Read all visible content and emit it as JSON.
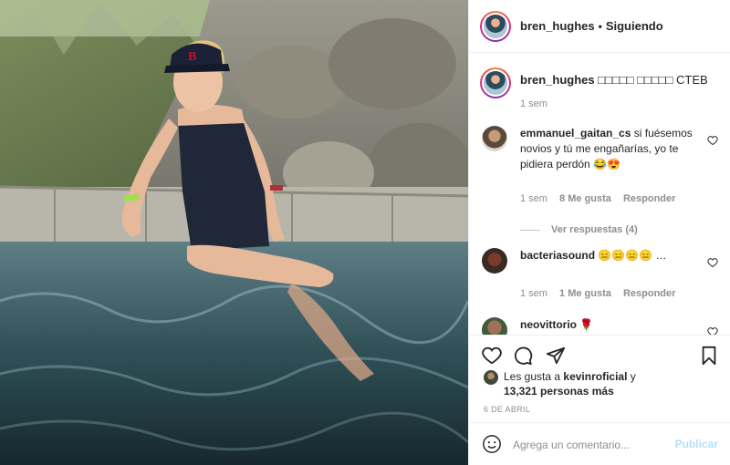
{
  "header": {
    "username": "bren_hughes",
    "separator": "•",
    "follow_status": "Siguiendo"
  },
  "caption": {
    "username": "bren_hughes",
    "text": "□□□□□ □□□□□ CTEB",
    "time": "1 sem"
  },
  "comments": [
    {
      "username": "emmanuel_gaitan_cs",
      "text": "si fuésemos novios y tú me engañarías, yo te pidiera perdón",
      "emoji": "😂😍",
      "time": "1 sem",
      "likes": "8 Me gusta",
      "reply": "Responder"
    },
    {
      "username": "bacteriasound",
      "text": "😑😑😑😑 …",
      "time": "1 sem",
      "likes": "1 Me gusta",
      "reply": "Responder"
    },
    {
      "username": "neovittorio",
      "text": "🌹"
    }
  ],
  "view_replies": "Ver respuestas (4)",
  "likes": {
    "line1_prefix": "Les gusta a",
    "line1_user": "kevinroficial",
    "line1_suffix": "y",
    "line2": "13,321 personas más"
  },
  "date": "6 DE ABRIL",
  "add_comment": {
    "placeholder": "Agrega un comentario...",
    "publish": "Publicar"
  },
  "icons": {
    "like": "heart-icon",
    "comment": "comment-icon",
    "share": "share-icon",
    "save": "bookmark-icon",
    "emoji": "smiley-icon"
  },
  "colors": {
    "publish_disabled": "#b2dffc",
    "meta_gray": "#8e8e8e",
    "text": "#262626"
  }
}
